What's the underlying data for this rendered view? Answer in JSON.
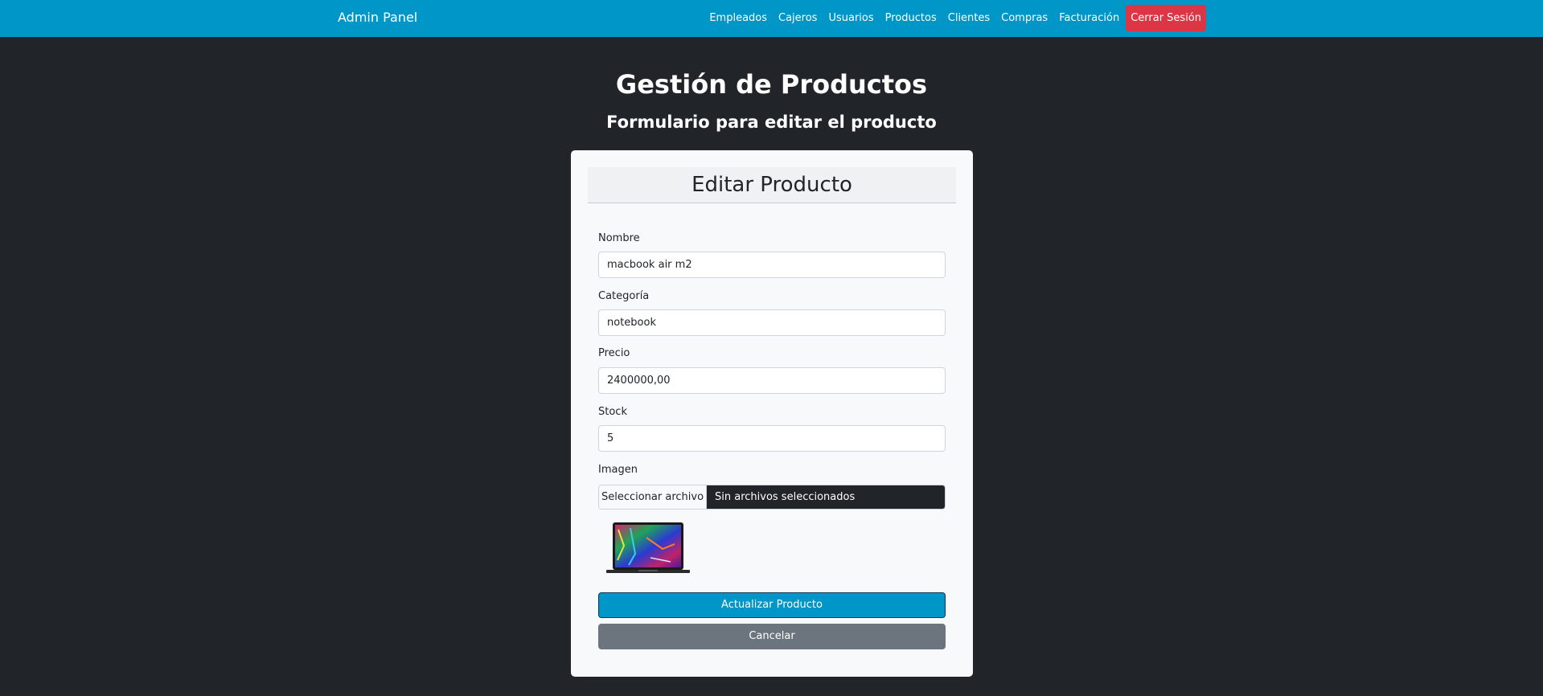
{
  "navbar": {
    "brand": "Admin Panel",
    "links": [
      "Empleados",
      "Cajeros",
      "Usuarios",
      "Productos",
      "Clientes",
      "Compras",
      "Facturación"
    ],
    "logout": "Cerrar Sesión",
    "color": "#0096c7",
    "logout_color": "#dc3545"
  },
  "page": {
    "title": "Gestión de Productos",
    "subtitle": "Formulario para editar el producto"
  },
  "card": {
    "header": "Editar Producto",
    "fields": {
      "nombre": {
        "label": "Nombre",
        "value": "macbook air m2"
      },
      "categoria": {
        "label": "Categoría",
        "value": "notebook"
      },
      "precio": {
        "label": "Precio",
        "value": "2400000,00"
      },
      "stock": {
        "label": "Stock",
        "value": "5"
      },
      "imagen": {
        "label": "Imagen",
        "button": "Seleccionar archivo",
        "status": "Sin archivos seleccionados"
      }
    },
    "thumbnail_icon": "laptop-thumbnail",
    "submit": "Actualizar Producto",
    "cancel": "Cancelar"
  }
}
